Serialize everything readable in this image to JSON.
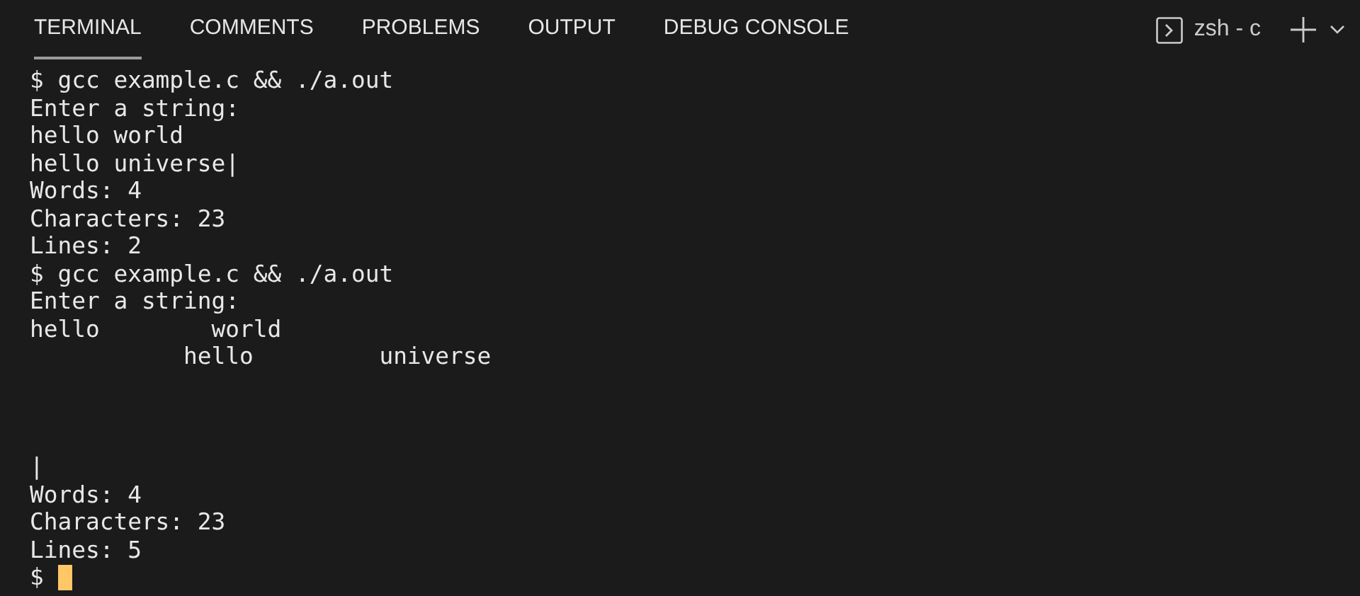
{
  "tabs": [
    {
      "label": "TERMINAL",
      "selected": true
    },
    {
      "label": "COMMENTS",
      "selected": false
    },
    {
      "label": "PROBLEMS",
      "selected": false
    },
    {
      "label": "OUTPUT",
      "selected": false
    },
    {
      "label": "DEBUG CONSOLE",
      "selected": false
    }
  ],
  "terminal_selector": {
    "label": "zsh - c"
  },
  "lines": [
    {
      "kind": "text",
      "text": "$ gcc example.c && ./a.out"
    },
    {
      "kind": "text",
      "text": "Enter a string:"
    },
    {
      "kind": "text",
      "text": "hello world"
    },
    {
      "kind": "text",
      "text": "hello universe|"
    },
    {
      "kind": "text",
      "text": "Words: 4"
    },
    {
      "kind": "text",
      "text": "Characters: 23"
    },
    {
      "kind": "text",
      "text": "Lines: 2"
    },
    {
      "kind": "text",
      "text": "$ gcc example.c && ./a.out"
    },
    {
      "kind": "text",
      "text": "Enter a string:"
    },
    {
      "kind": "text",
      "text": "hello        world"
    },
    {
      "kind": "text",
      "text": "           hello         universe"
    },
    {
      "kind": "blank"
    },
    {
      "kind": "blank"
    },
    {
      "kind": "blank"
    },
    {
      "kind": "text",
      "text": "|"
    },
    {
      "kind": "text",
      "text": "Words: 4"
    },
    {
      "kind": "text",
      "text": "Characters: 23"
    },
    {
      "kind": "text",
      "text": "Lines: 5"
    },
    {
      "kind": "prompt",
      "text": "$"
    }
  ]
}
